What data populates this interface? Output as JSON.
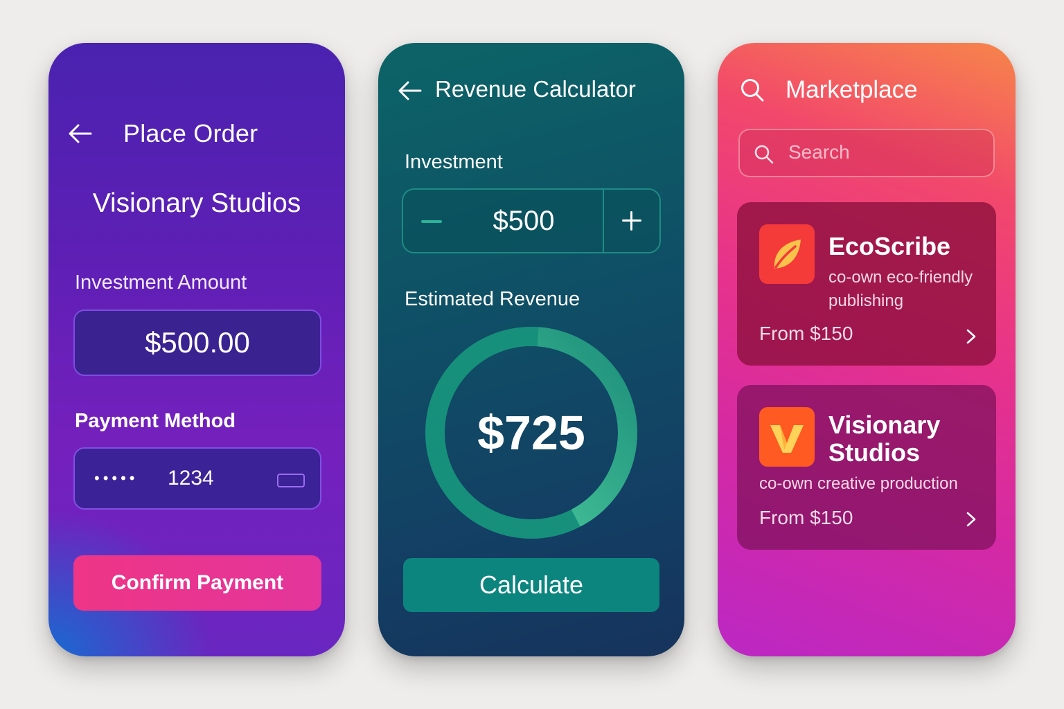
{
  "place_order": {
    "title": "Place Order",
    "studio_name": "Visionary Studios",
    "investment_label": "Investment Amount",
    "investment_value": "$500.00",
    "payment_label": "Payment Method",
    "card_mask": "•••••",
    "card_last4": "1234",
    "confirm_label": "Confirm Payment"
  },
  "revenue_calculator": {
    "title": "Revenue Calculator",
    "investment_label": "Investment",
    "investment_value": "$500",
    "estimated_label": "Estimated Revenue",
    "estimated_value": "$725",
    "calculate_label": "Calculate"
  },
  "marketplace": {
    "title": "Marketplace",
    "search_placeholder": "Search",
    "items": [
      {
        "name": "EcoScribe",
        "description": "co-own eco-friendly publishing",
        "price": "From $150",
        "logo": "leaf-icon"
      },
      {
        "name": "Visionary Studios",
        "description": "co-own creative production",
        "price": "From $150",
        "logo": "v-letter-icon"
      }
    ]
  },
  "colors": {
    "confirm_button": "#e83590",
    "calculate_button": "#0c857f",
    "gauge_track": "#1a8f7c",
    "gauge_accent": "#4cc79a",
    "ecoscribe_logo": "#f53a3a",
    "visionary_logo": "#ff5a22"
  }
}
